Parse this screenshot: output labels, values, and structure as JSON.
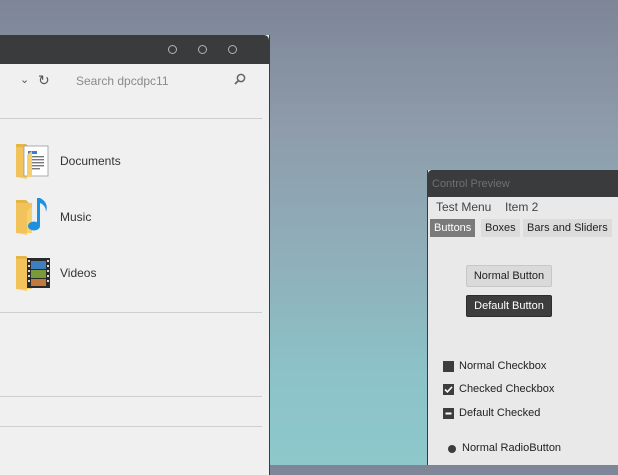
{
  "explorer": {
    "search_placeholder": "Search dpcdpc11",
    "items": [
      {
        "label": "Documents",
        "icon": "folder-documents-icon"
      },
      {
        "label": "Music",
        "icon": "folder-music-icon"
      },
      {
        "label": "Videos",
        "icon": "folder-videos-icon"
      }
    ]
  },
  "preview": {
    "title": "Control Preview",
    "menu": [
      "Test Menu",
      "Item 2"
    ],
    "tabs": [
      "Buttons",
      "Boxes",
      "Bars and Sliders"
    ],
    "active_tab": "Buttons",
    "buttons": {
      "normal": "Normal Button",
      "default": "Default Button"
    },
    "checkboxes": [
      {
        "label": "Normal Checkbox",
        "state": "unchecked"
      },
      {
        "label": "Checked Checkbox",
        "state": "checked"
      },
      {
        "label": "Default Checked",
        "state": "indeterminate"
      }
    ],
    "radio": {
      "label": "Normal RadioButton"
    }
  },
  "colors": {
    "titlebar": "#3a3b3c",
    "folder": "#f2c35a",
    "music_note": "#1f8fe0"
  }
}
